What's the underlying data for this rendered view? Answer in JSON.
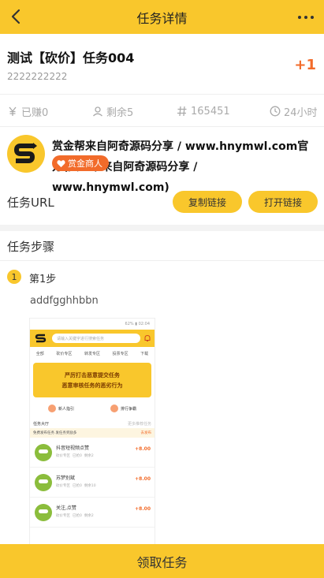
{
  "header": {
    "title": "任务详情"
  },
  "task": {
    "title": "测试【砍价】任务004",
    "subtitle": "2222222222",
    "reward": "+1"
  },
  "stats": {
    "earned": "已赚0",
    "remaining": "剩余5",
    "id": "165451",
    "time": "24小时"
  },
  "publisher": {
    "name": "赏金帮来自阿奇源码分享 / www.hnymwl.com官方(赏金帮来自阿奇源码分享 / www.hnymwl.com)",
    "badge": "赏金商人"
  },
  "url_row": {
    "label": "任务URL",
    "copy_label": "复制链接",
    "open_label": "打开链接"
  },
  "steps": {
    "title": "任务步骤",
    "items": [
      {
        "number": "1",
        "label": "第1步",
        "text": "addfgghhbbn"
      }
    ]
  },
  "screenshot": {
    "status": "62% ▮ 02:04",
    "search_placeholder": "请输入关键字进行搜索任务",
    "tabs": [
      "全部",
      "砍价专区",
      "转发专区",
      "投票专区",
      "下载"
    ],
    "banner_line1": "严厉打击恶意提交任务",
    "banner_line2": "恶意审核任务的恶劣行为",
    "link1": "新人指引",
    "link2": "排行争霸",
    "hall_title": "任务大厅",
    "hall_more": "更多推荐任务",
    "notice": "免费发布任务 发任务奖励多",
    "notice_action": "去发布",
    "items": [
      {
        "name": "抖音短视频点赞",
        "tags": [
          "砍价专区",
          "已抢0",
          "剩余2"
        ],
        "price": "+8.00"
      },
      {
        "name": "苏梦别斌",
        "tags": [
          "砍价专区",
          "已抢0",
          "剩余10"
        ],
        "price": "+8.00"
      },
      {
        "name": "关注,点赞",
        "tags": [
          "砍价专区",
          "已抢0",
          "剩余2"
        ],
        "price": "+8.00"
      }
    ]
  },
  "bottom": {
    "action_label": "领取任务"
  },
  "colors": {
    "accent": "#f9c72c",
    "reward": "#f26b2a",
    "muted": "#aaaaaa"
  }
}
